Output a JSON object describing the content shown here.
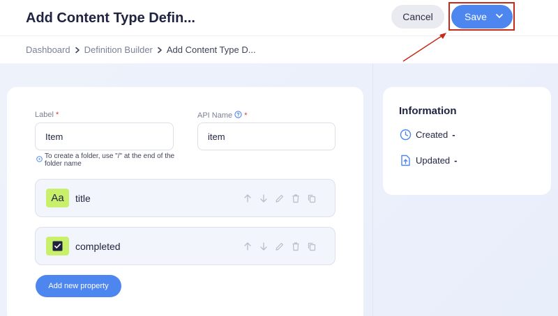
{
  "header": {
    "title": "Add Content Type Defin...",
    "cancel_label": "Cancel",
    "save_label": "Save"
  },
  "breadcrumb": [
    "Dashboard",
    "Definition Builder",
    "Add Content Type D..."
  ],
  "form": {
    "label_field": {
      "label": "Label",
      "required_mark": "*",
      "value": "Item"
    },
    "api_name_field": {
      "label": "API Name",
      "required_mark": "*",
      "value": "item"
    },
    "hint": "To create a folder, use \"/\" at the end of the folder name"
  },
  "properties": [
    {
      "name": "title",
      "type_icon": "text-type-icon",
      "icon_text": "Aa"
    },
    {
      "name": "completed",
      "type_icon": "checkbox-type-icon"
    }
  ],
  "add_property_label": "Add new property",
  "information": {
    "title": "Information",
    "created_label": "Created",
    "created_value": "-",
    "updated_label": "Updated",
    "updated_value": "-"
  },
  "colors": {
    "primary": "#4d86ef",
    "accent_green": "#c9f06a",
    "annotation_red": "#c62a1b"
  }
}
